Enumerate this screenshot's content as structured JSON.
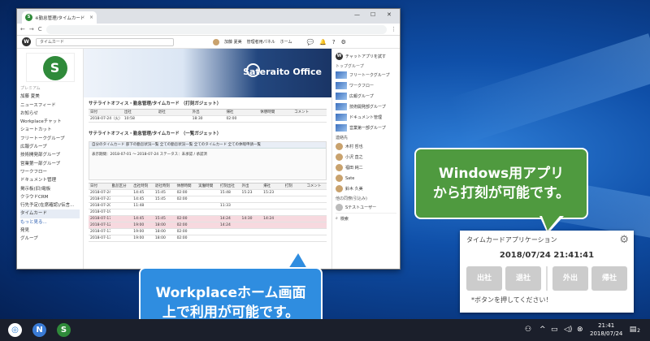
{
  "browser": {
    "tab_title": "※勤怠管理/タイムカード",
    "tab_close": "×",
    "window_controls": [
      "—",
      "☐",
      "✕"
    ],
    "nav_icons": [
      "←",
      "→",
      "C"
    ],
    "url": ""
  },
  "app_header": {
    "logo": "W",
    "search_placeholder": "タイムカード",
    "user_name": "加藤 夏美",
    "admin_panel": "管理者用パネル",
    "home": "ホーム",
    "icons": [
      "💬",
      "🔔",
      "?",
      "⚙"
    ]
  },
  "left_nav": {
    "logo_letter": "S",
    "org": "プレミアム",
    "user": "加藤 夏美",
    "items": [
      "ニュースフィード",
      "お知らせ",
      "Workplaceチャット",
      "ショートカット",
      "フリートークグループ",
      "広報グループ",
      "技術開発部グループ",
      "営業第一部グループ",
      "ワークフロー",
      "ドキュメント管理",
      "掲示板(旧)電板",
      "クラウドCRM",
      "行先予定(在席確認)/伝言...",
      "タイムカード",
      "もっと見る...",
      "発見",
      "グループ"
    ]
  },
  "main": {
    "banner_brand": "Sateraito Office",
    "card_title": "サテライトオフィス・勤怠管理/タイムカード （打刻ガジェット）",
    "today_headers": [
      "日付",
      "出社",
      "退社",
      "外出",
      "帰社",
      "休憩時間",
      "コメント"
    ],
    "today_row": [
      "2018-07-24（火）",
      "10:58",
      "",
      "18:30",
      "02:00",
      "",
      ""
    ],
    "sub_title": "サテライトオフィス・勤怠管理/タイムカード （一覧ガジェット）",
    "sub_tabs": "自分のタイムカード   部下の勤怠状況一覧   全ての勤怠状況一覧   全てのタイムカード   全ての休暇申請一覧",
    "filter_text": "表示期間：2018-07-01 〜 2018-07-24   ステータス：未承認 / 承認済",
    "list_headers": [
      "日付",
      "勤怠区分",
      "出社時刻",
      "退社時刻",
      "休憩時間",
      "実働時間",
      "打刻出社",
      "外出",
      "帰社",
      "打刻",
      "コメント"
    ],
    "list_rows": [
      [
        "2018-07-24（火）",
        "",
        "14:45",
        "15:45",
        "02:00",
        "",
        "15:48",
        "15:23",
        "15:23",
        "",
        ""
      ],
      [
        "2018-07-23（月）",
        "",
        "14:45",
        "15:45",
        "02:00",
        "",
        "",
        "",
        "",
        "",
        ""
      ],
      [
        "2018-07-20（金）",
        "",
        "11:48",
        "",
        "",
        "",
        "11:33",
        "",
        "",
        "",
        ""
      ],
      [
        "2018-07-19（木）",
        "",
        "",
        "",
        "",
        "",
        "",
        "",
        "",
        "",
        ""
      ],
      [
        "2018-07-17（火）",
        "",
        "14:45",
        "15:45",
        "02:00",
        "",
        "14:24",
        "14:30",
        "14:24",
        "",
        ""
      ],
      [
        "2018-07-12（木）",
        "",
        "19:00",
        "18:00",
        "02:00",
        "",
        "14:24",
        "",
        "",
        "",
        ""
      ],
      [
        "2018-07-13（金）",
        "",
        "19:00",
        "18:00",
        "02:00",
        "",
        "",
        "",
        "",
        "",
        ""
      ],
      [
        "2018-07-13（金）",
        "",
        "19:00",
        "18:00",
        "02:00",
        "",
        "",
        "",
        "",
        "",
        ""
      ]
    ]
  },
  "right_panel": {
    "chat_try": "チャットアプリを試す",
    "groups_title": "トップグループ",
    "groups": [
      "フリートークグループ",
      "ワークフロー",
      "広報グループ",
      "技術開発部グループ",
      "ドキュメント管理",
      "営業第一部グループ"
    ],
    "contacts_title": "連絡先",
    "contacts": [
      "木村 哲也",
      "小沢 直之",
      "福田 純二",
      "Sate",
      "鈴木 久美"
    ],
    "others_title": "他の同僚(引込み)",
    "others": [
      "Sテストユーザー"
    ],
    "search_placeholder": "検索"
  },
  "callouts": {
    "windows_line1": "Windows用アプリ",
    "windows_line2": "から打刻が可能です。",
    "workplace_line1": "Workplaceホーム画面",
    "workplace_line2": "上で利用が可能です。"
  },
  "timecard_widget": {
    "title": "タイムカードアプリケーション",
    "datetime": "2018/07/24 21:41:41",
    "buttons": [
      "出社",
      "退社",
      "外出",
      "帰社"
    ],
    "note": "*ボタンを押してください！"
  },
  "taskbar": {
    "clock_time": "21:41",
    "clock_date": "2018/07/24",
    "notification_count": "2"
  }
}
